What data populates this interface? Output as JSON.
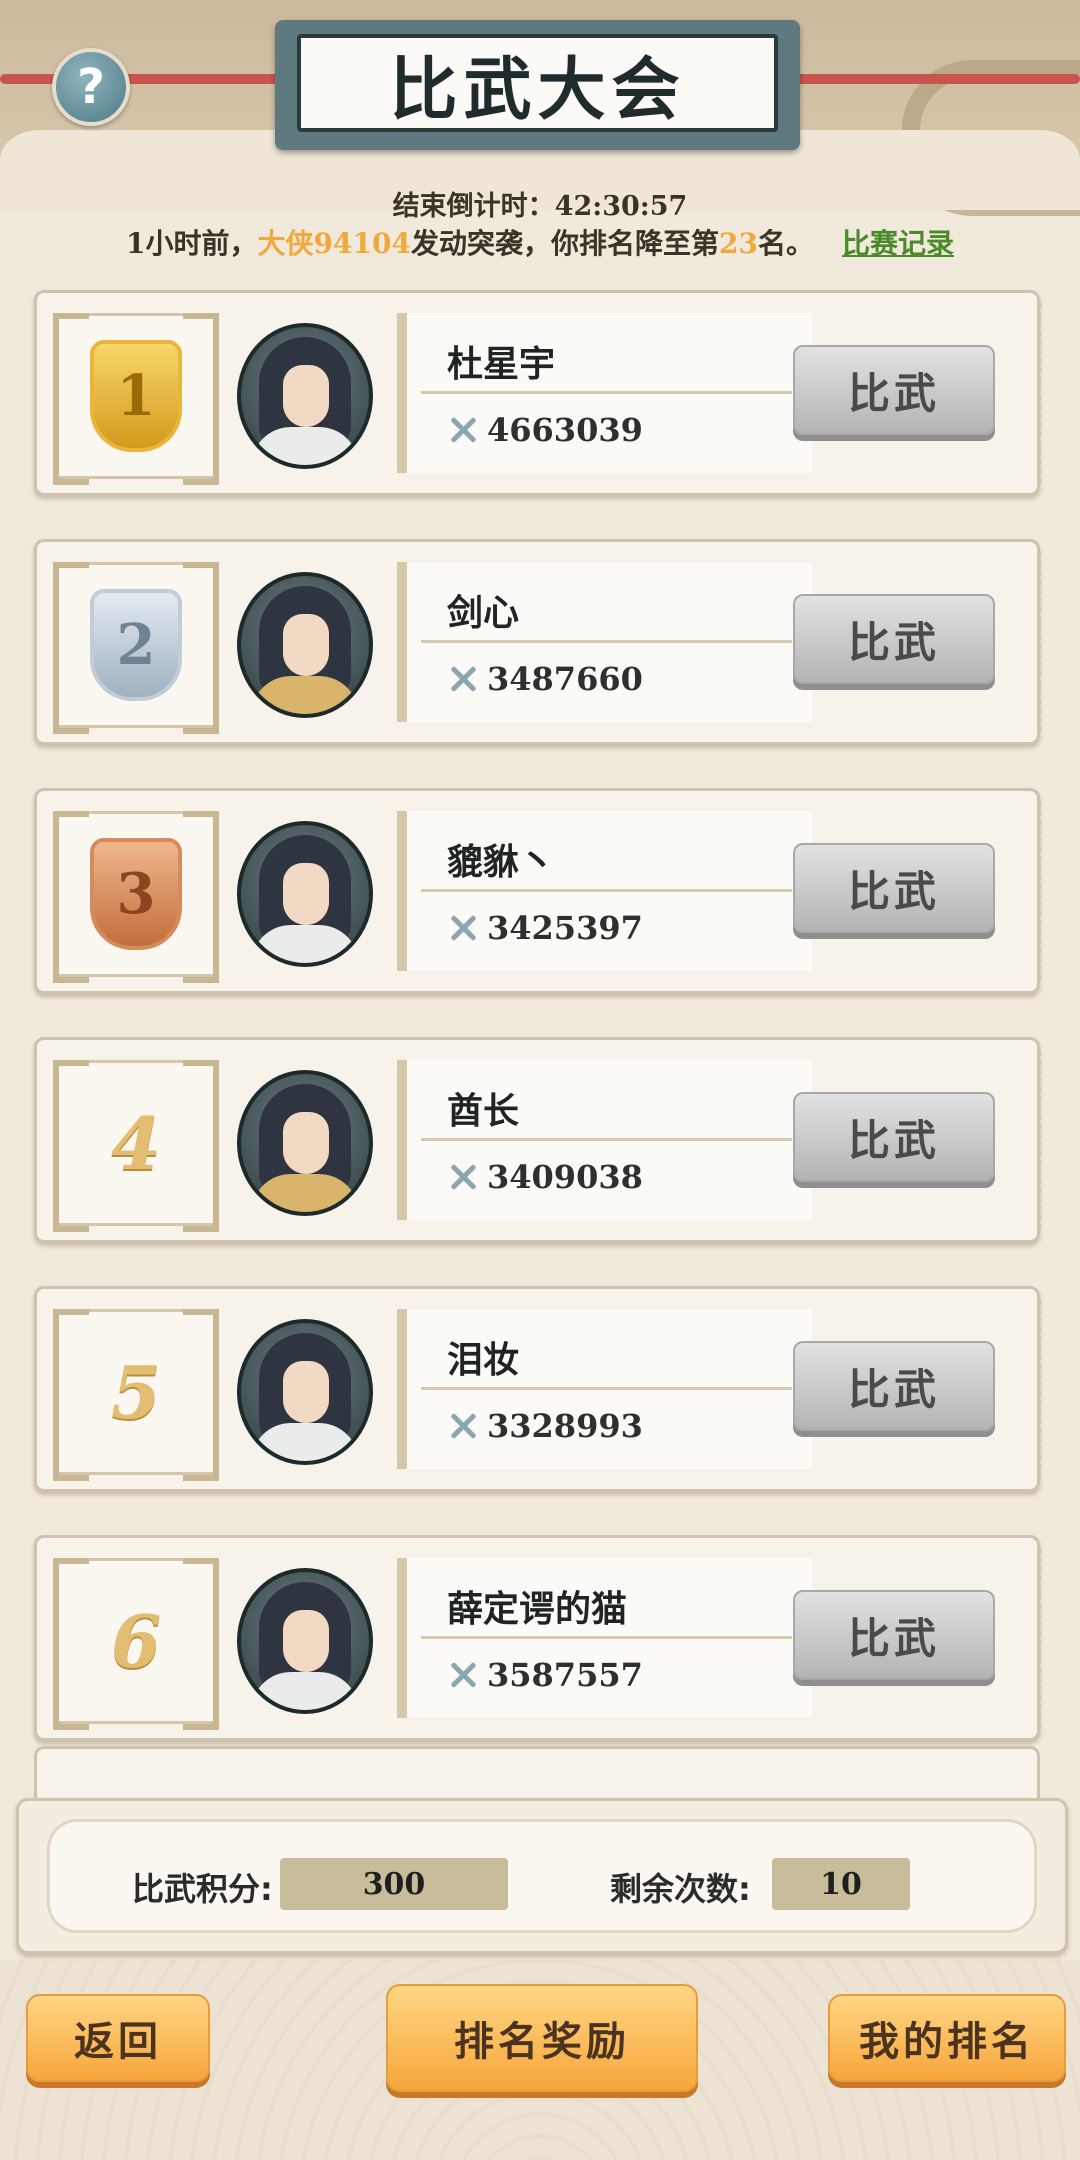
{
  "header": {
    "title": "比武大会",
    "help_symbol": "?",
    "countdown": "结束倒计时：42:30:57"
  },
  "notice": {
    "prefix": "1小时前，",
    "attacker_title": "大侠",
    "attacker_id": "94104",
    "middle": "发动突袭，你排名降至第",
    "rank": "23",
    "suffix": "名。",
    "record_link": "比赛记录"
  },
  "ranking": [
    {
      "rank": "1",
      "medal": "gold",
      "name": "杜星宇",
      "power": "4663039",
      "button": "比武"
    },
    {
      "rank": "2",
      "medal": "silver",
      "name": "剑心",
      "power": "3487660",
      "button": "比武"
    },
    {
      "rank": "3",
      "medal": "bronze",
      "name": "貔貅丶",
      "power": "3425397",
      "button": "比武"
    },
    {
      "rank": "4",
      "medal": "none",
      "name": "酋长",
      "power": "3409038",
      "button": "比武"
    },
    {
      "rank": "5",
      "medal": "none",
      "name": "泪妆",
      "power": "3328993",
      "button": "比武"
    },
    {
      "rank": "6",
      "medal": "none",
      "name": "薛定谔的猫",
      "power": "3587557",
      "button": "比武"
    }
  ],
  "stats": {
    "score_label": "比武积分:",
    "score_value": "300",
    "remaining_label": "剩余次数:",
    "remaining_value": "10"
  },
  "buttons": {
    "back": "返回",
    "reward": "排名奖励",
    "my_rank": "我的排名"
  },
  "colors": {
    "highlight": "#f0a93c",
    "link": "#4b8a2a",
    "action_orange": "#f6a63b"
  }
}
